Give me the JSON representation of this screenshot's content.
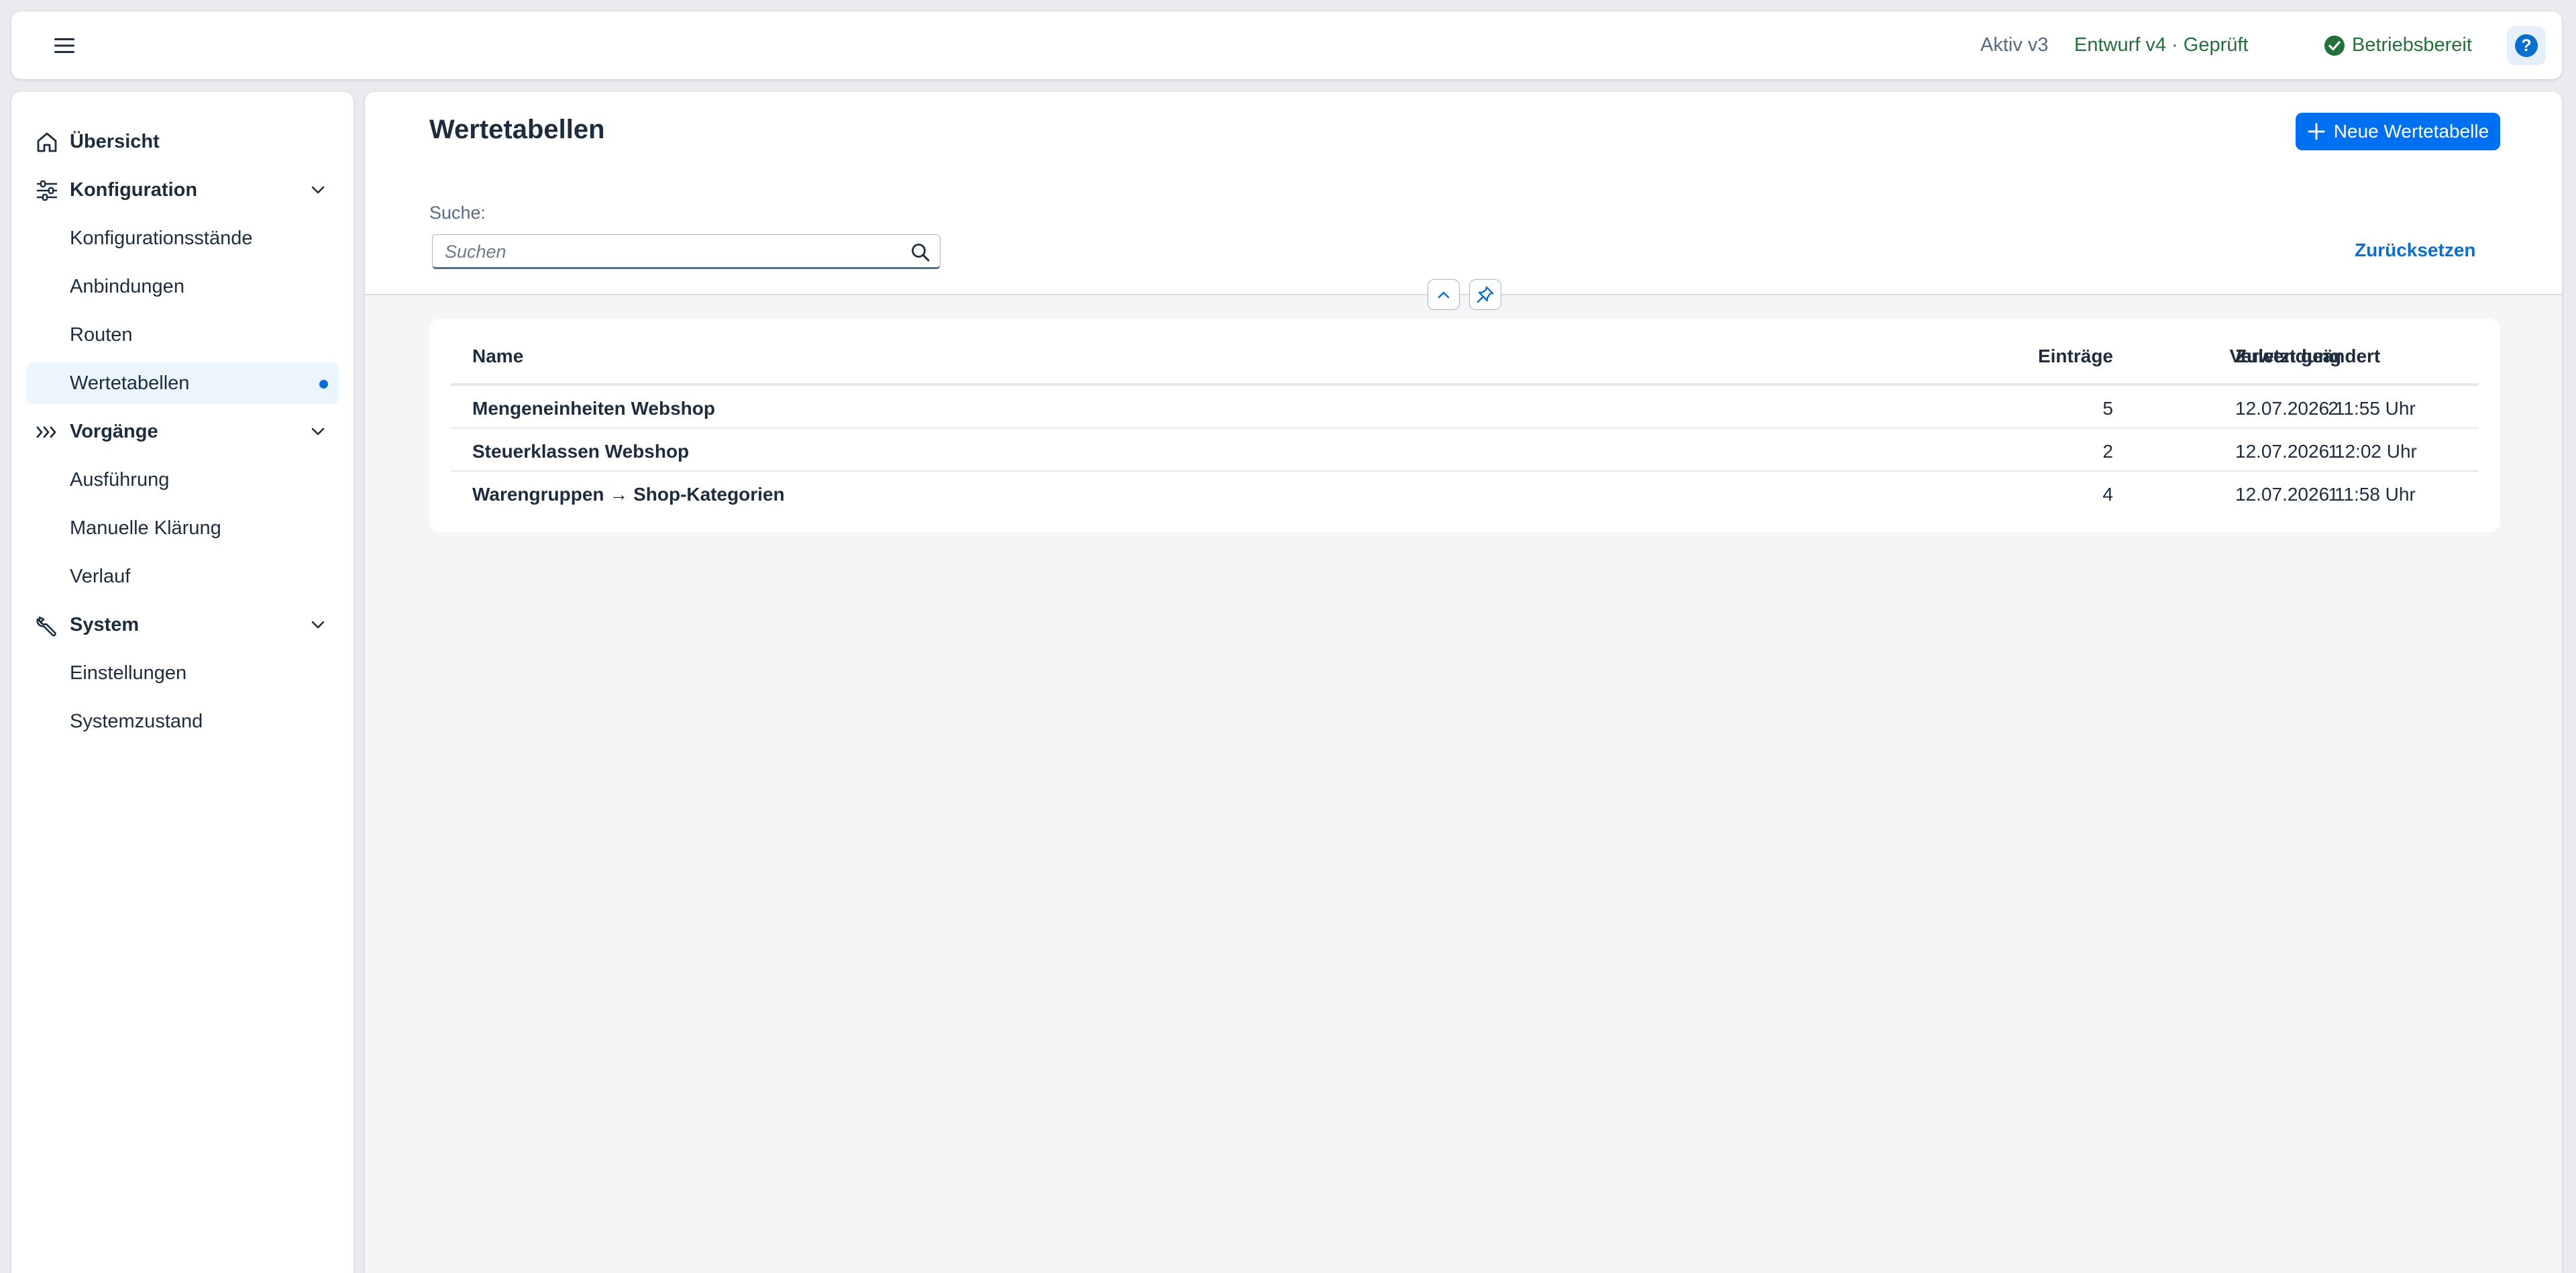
{
  "header": {
    "active_version": "Aktiv v3",
    "draft_status": "Entwurf v4 · Geprüft",
    "operational_status": "Betriebsbereit",
    "help_label": "?"
  },
  "sidebar": {
    "items": [
      {
        "label": "Übersicht",
        "level": "top",
        "icon": "home-icon"
      },
      {
        "label": "Konfiguration",
        "level": "top",
        "icon": "sliders-icon",
        "expanded": true
      },
      {
        "label": "Konfigurationsstände",
        "level": "sub"
      },
      {
        "label": "Anbindungen",
        "level": "sub"
      },
      {
        "label": "Routen",
        "level": "sub"
      },
      {
        "label": "Wertetabellen",
        "level": "sub",
        "selected": true
      },
      {
        "label": "Vorgänge",
        "level": "top",
        "icon": "process-icon",
        "expanded": true
      },
      {
        "label": "Ausführung",
        "level": "sub"
      },
      {
        "label": "Manuelle Klärung",
        "level": "sub"
      },
      {
        "label": "Verlauf",
        "level": "sub"
      },
      {
        "label": "System",
        "level": "top",
        "icon": "wrench-icon",
        "expanded": true
      },
      {
        "label": "Einstellungen",
        "level": "sub"
      },
      {
        "label": "Systemzustand",
        "level": "sub"
      }
    ]
  },
  "main": {
    "title": "Wertetabellen",
    "new_button_label": "Neue Wertetabelle",
    "search": {
      "label": "Suche:",
      "placeholder": "Suchen",
      "value": ""
    },
    "reset_label": "Zurücksetzen",
    "table": {
      "columns": [
        "Name",
        "Einträge",
        "Verwendung",
        "Zuletzt geändert"
      ],
      "rows": [
        {
          "name": "Mengeneinheiten Webshop",
          "entries": "5",
          "usage": "2",
          "modified": "12.07.2026 11:55 Uhr"
        },
        {
          "name": "Steuerklassen Webshop",
          "entries": "2",
          "usage": "1",
          "modified": "12.07.2026 12:02 Uhr"
        },
        {
          "name": "Warengruppen → Shop-Kategorien",
          "entries": "4",
          "usage": "1",
          "modified": "12.07.2026 11:58 Uhr"
        }
      ]
    }
  },
  "colors": {
    "accent": "#0070f2",
    "positive": "#256f3a",
    "selected_bg": "#eaf5fe"
  }
}
